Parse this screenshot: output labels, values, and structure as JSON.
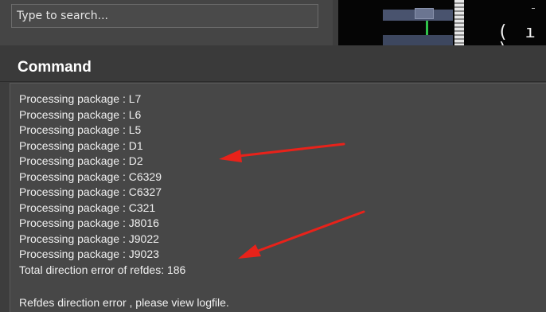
{
  "search": {
    "placeholder": "Type to search..."
  },
  "canvas_preview": {
    "glyph_text": "( ı )"
  },
  "command_panel": {
    "title": "Command",
    "log_lines": [
      "Processing package : L7",
      "Processing package : L6",
      "Processing package : L5",
      "Processing package : D1",
      "Processing package : D2",
      "Processing package : C6329",
      "Processing package : C6327",
      "Processing package : C321",
      "Processing package : J8016",
      "Processing package : J9022",
      "Processing package : J9023",
      "Total direction error of refdes: 186"
    ],
    "footer_message": "Refdes direction error , please view logfile."
  },
  "colors": {
    "panel_bg": "#474747",
    "text": "#f0f0f0",
    "annotation_arrow": "#e8221a"
  },
  "icons": {
    "annotation": "red-arrow-icon"
  }
}
